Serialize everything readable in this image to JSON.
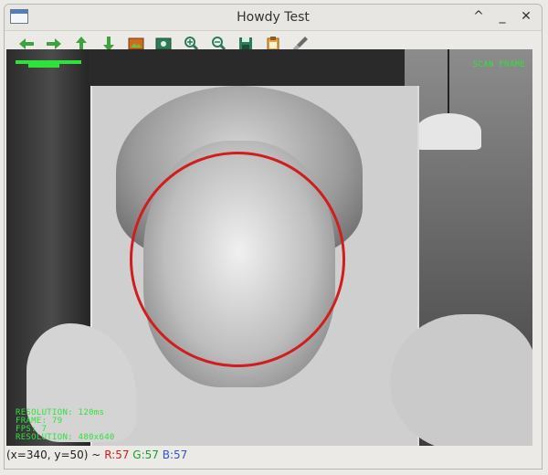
{
  "window": {
    "title": "Howdy Test"
  },
  "titlebar": {
    "controls": [
      "chevron-up",
      "minimize",
      "close"
    ]
  },
  "toolbar": {
    "buttons": [
      {
        "name": "pan-left",
        "icon": "arrow-left-icon"
      },
      {
        "name": "pan-right",
        "icon": "arrow-right-icon"
      },
      {
        "name": "pan-up",
        "icon": "arrow-up-icon"
      },
      {
        "name": "pan-down",
        "icon": "arrow-down-icon"
      },
      {
        "name": "image",
        "icon": "image-icon"
      },
      {
        "name": "zoom-fit",
        "icon": "zoom-fit-icon"
      },
      {
        "name": "zoom-in",
        "icon": "zoom-in-icon"
      },
      {
        "name": "zoom-out",
        "icon": "zoom-out-icon"
      },
      {
        "name": "save",
        "icon": "save-icon"
      },
      {
        "name": "copy",
        "icon": "clipboard-icon"
      },
      {
        "name": "properties",
        "icon": "brush-icon"
      }
    ]
  },
  "viewport": {
    "hud": {
      "scan": "SCAN FRAME",
      "stats": [
        "RESOLUTION: 120ms",
        "FRAME: 79",
        "FPS: 7",
        "RESOLUTION: 480x640"
      ]
    }
  },
  "statusbar": {
    "coords": "(x=340, y=50) ~",
    "r": "R:57",
    "g": "G:57",
    "b": "B:57"
  },
  "colors": {
    "hud_green": "#2fe23a",
    "detection_red": "#d11d1d",
    "status_r": "#d11d1d",
    "status_g": "#1b9d2a",
    "status_b": "#2c55c9"
  }
}
